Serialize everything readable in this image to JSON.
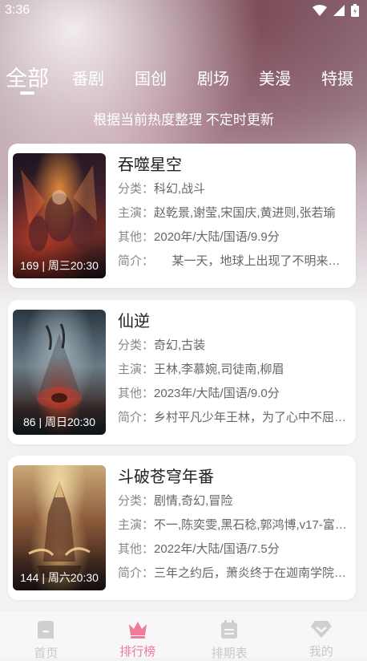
{
  "status_bar": {
    "time": "3:36"
  },
  "tabs": [
    {
      "label": "全部",
      "active": true
    },
    {
      "label": "番剧",
      "active": false
    },
    {
      "label": "国创",
      "active": false
    },
    {
      "label": "剧场",
      "active": false
    },
    {
      "label": "美漫",
      "active": false
    },
    {
      "label": "特摄",
      "active": false
    }
  ],
  "subtitle": "根据当前热度整理 不定时更新",
  "labels": {
    "category": "分类：",
    "cast": "主演：",
    "other": "其他：",
    "intro": "简介："
  },
  "items": [
    {
      "title": "吞噬星空",
      "category": "科幻,战斗",
      "cast": "赵乾景,谢莹,宋国庆,黄进则,张若瑜",
      "other": "2020年/大陆/国语/9.9分",
      "intro": "　　某一天，地球上出现了不明来…",
      "poster_caption": "169 | 周三20:30",
      "poster_colors": [
        "#3a1f2b",
        "#b33a2a",
        "#e08a3a"
      ]
    },
    {
      "title": "仙逆",
      "category": "奇幻,古装",
      "cast": "王林,李慕婉,司徒南,柳眉",
      "other": "2023年/大陆/国语/9.0分",
      "intro": "乡村平凡少年王林，为了心中不屈…",
      "poster_caption": "86 | 周日20:30",
      "poster_colors": [
        "#1e2a33",
        "#6a7b86",
        "#c0462e"
      ]
    },
    {
      "title": "斗破苍穹年番",
      "category": "剧情,奇幻,冒险",
      "cast": "不一,陈奕雯,黑石稔,郭鸿博,v17-富…",
      "other": "2022年/大陆/国语/7.5分",
      "intro": "三年之约后，萧炎终于在迦南学院…",
      "poster_caption": "144 | 周六20:30",
      "poster_colors": [
        "#2c2320",
        "#8a5a3a",
        "#e0b070"
      ]
    }
  ],
  "bottom_nav": [
    {
      "label": "首页",
      "icon": "home-icon",
      "active": false
    },
    {
      "label": "排行榜",
      "icon": "crown-icon",
      "active": true
    },
    {
      "label": "排期表",
      "icon": "calendar-icon",
      "active": false
    },
    {
      "label": "我的",
      "icon": "diamond-icon",
      "active": false
    }
  ],
  "colors": {
    "accent": "#ef7a9a",
    "inactive": "#c8c8c8"
  }
}
